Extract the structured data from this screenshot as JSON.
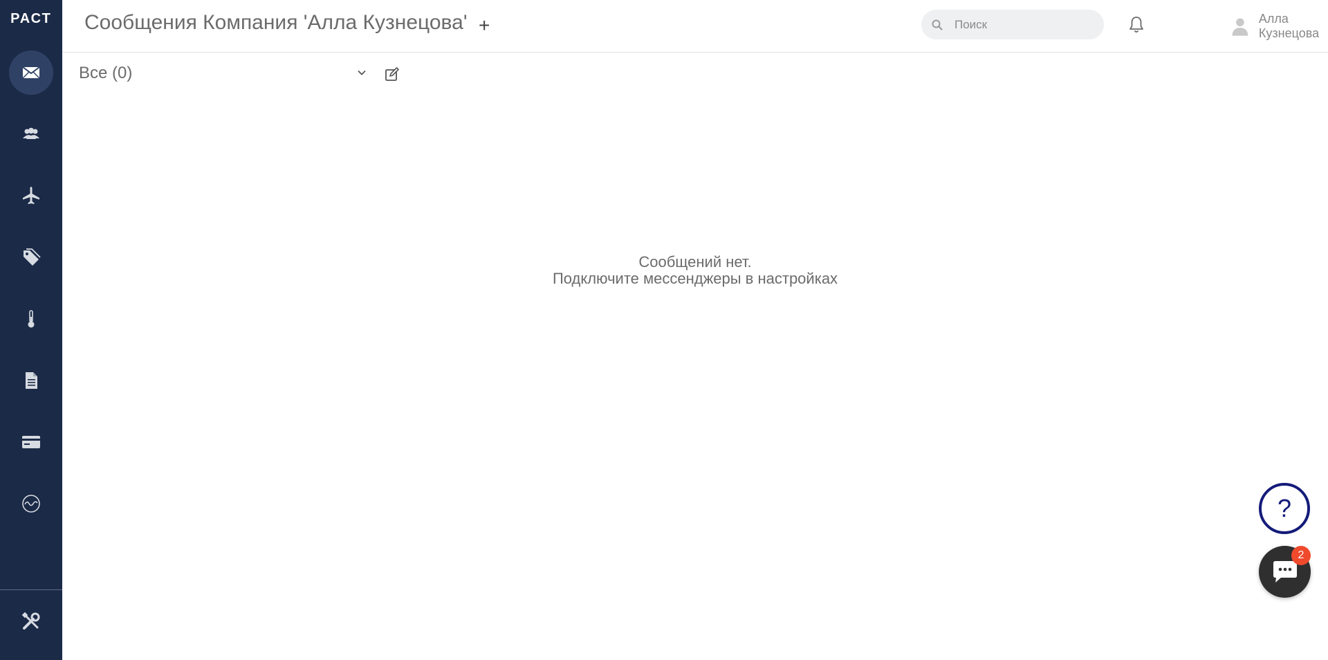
{
  "sidebar": {
    "logo": "РАСТ",
    "items": [
      {
        "name": "messages",
        "icon": "envelope-icon",
        "active": true
      },
      {
        "name": "clients",
        "icon": "users-icon",
        "active": false
      },
      {
        "name": "tours",
        "icon": "airplane-icon",
        "active": false
      },
      {
        "name": "tags",
        "icon": "tag-icon",
        "active": false
      },
      {
        "name": "temperature",
        "icon": "thermometer-icon",
        "active": false
      },
      {
        "name": "documents",
        "icon": "document-icon",
        "active": false
      },
      {
        "name": "payments",
        "icon": "credit-card-icon",
        "active": false
      },
      {
        "name": "analytics",
        "icon": "pulse-icon",
        "active": false
      },
      {
        "name": "settings",
        "icon": "tools-icon",
        "active": false
      }
    ]
  },
  "header": {
    "title": "Сообщения Компания 'Алла Кузнецова'",
    "add_label": "+",
    "search_placeholder": "Поиск",
    "user_name": "Алла Кузнецова"
  },
  "filter": {
    "label": "Все (0)"
  },
  "empty_state": {
    "line1": "Сообщений нет.",
    "line2": "Подключите мессенджеры в настройках"
  },
  "fab": {
    "help_label": "?",
    "chat_badge": "2"
  },
  "colors": {
    "sidebar_bg": "#1b2a47",
    "sidebar_active": "#2f4266",
    "help_border": "#141b7a",
    "badge": "#f04a2c"
  }
}
